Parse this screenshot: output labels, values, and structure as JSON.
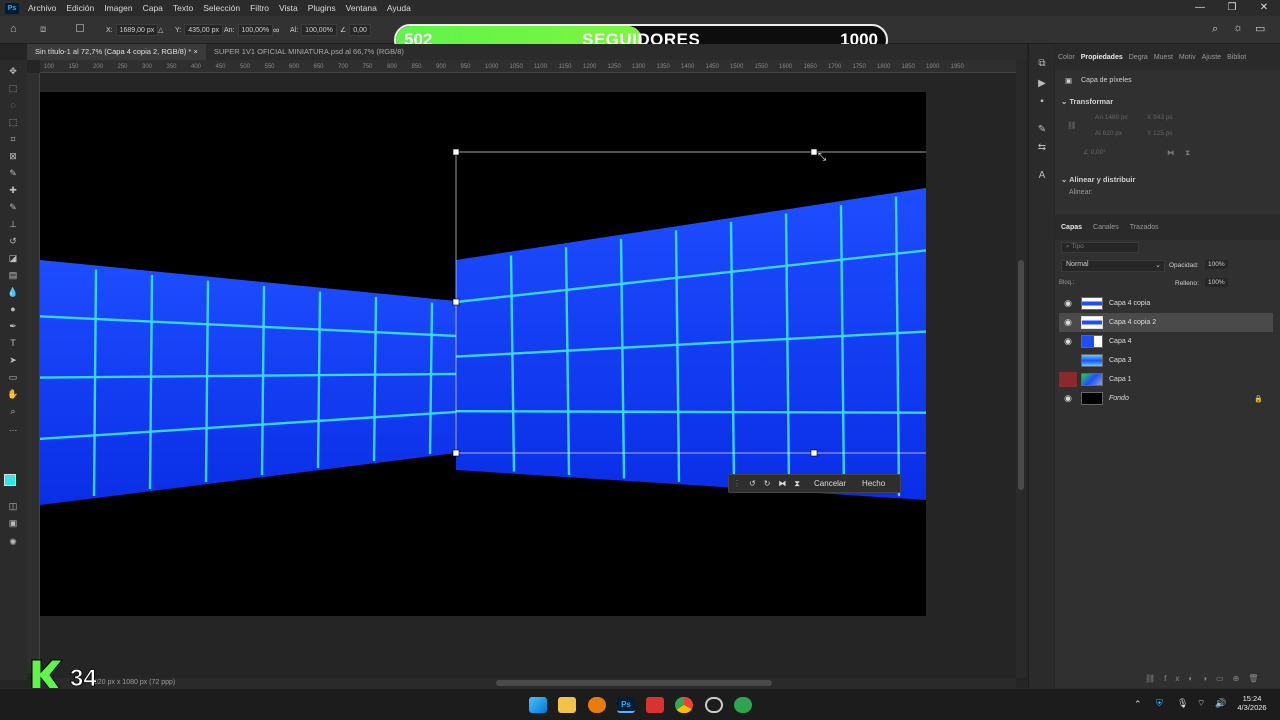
{
  "menu": [
    "Archivo",
    "Edición",
    "Imagen",
    "Capa",
    "Texto",
    "Selección",
    "Filtro",
    "Vista",
    "Plugins",
    "Ventana",
    "Ayuda"
  ],
  "options": {
    "x": "1689,00 px",
    "y": "435,00 px",
    "w_label": "An:",
    "w": "100,00%",
    "h_label": "Al:",
    "h": "100,00%",
    "angle": "0,00"
  },
  "tabs": [
    "Sin título-1 al 72,7% (Capa 4 copia 2, RGB/8) *",
    "SUPER 1V1 OFICIAL MINIATURA.psd al 66,7% (RGB/8)"
  ],
  "ruler_ticks": [
    "100",
    "150",
    "200",
    "250",
    "300",
    "350",
    "400",
    "450",
    "500",
    "550",
    "600",
    "650",
    "700",
    "750",
    "800",
    "850",
    "900",
    "950",
    "1000",
    "1050",
    "1100",
    "1150",
    "1200",
    "1250",
    "1300",
    "1350",
    "1400",
    "1450",
    "1500",
    "1550",
    "1600",
    "1650",
    "1700",
    "1750",
    "1800",
    "1850",
    "1900",
    "1950"
  ],
  "followers": {
    "current": "502",
    "label": "SEGUIDORES",
    "goal": "1000",
    "progress": 0.502
  },
  "context_bar": {
    "cancel": "Cancelar",
    "done": "Hecho"
  },
  "status": "1920 px x 1080 px (72 ppp)",
  "right_tabs": [
    "Color",
    "Propiedades",
    "Degra",
    "Muest",
    "Motiv",
    "Ajuste",
    "Bibliot"
  ],
  "properties": {
    "type": "Capa de píxeles",
    "transform": "Transformar",
    "an": "1480 px",
    "x": "943 px",
    "al": "620 px",
    "y": "125 px",
    "angle": "0,00°",
    "align": "Alinear y distribuir",
    "align_label": "Alinear:"
  },
  "layers_tabs": [
    "Capas",
    "Canales",
    "Trazados"
  ],
  "layers_search": "Tipo",
  "blend": "Normal",
  "opacity_label": "Opacidad:",
  "opacity": "100%",
  "lock_label": "Bloq.:",
  "fill_label": "Relleno:",
  "fill": "100%",
  "layers": [
    {
      "name": "Capa 4 copia",
      "visible": true,
      "selected": false
    },
    {
      "name": "Capa 4 copia 2",
      "visible": true,
      "selected": true
    },
    {
      "name": "Capa 4",
      "visible": true,
      "selected": false
    },
    {
      "name": "Capa 3",
      "visible": false,
      "selected": false
    },
    {
      "name": "Capa 1",
      "visible": false,
      "selected": false
    },
    {
      "name": "Fondo",
      "visible": true,
      "selected": false
    }
  ],
  "clock": {
    "time": "15:24",
    "date": "4/3/2026"
  },
  "logo_text": "34"
}
